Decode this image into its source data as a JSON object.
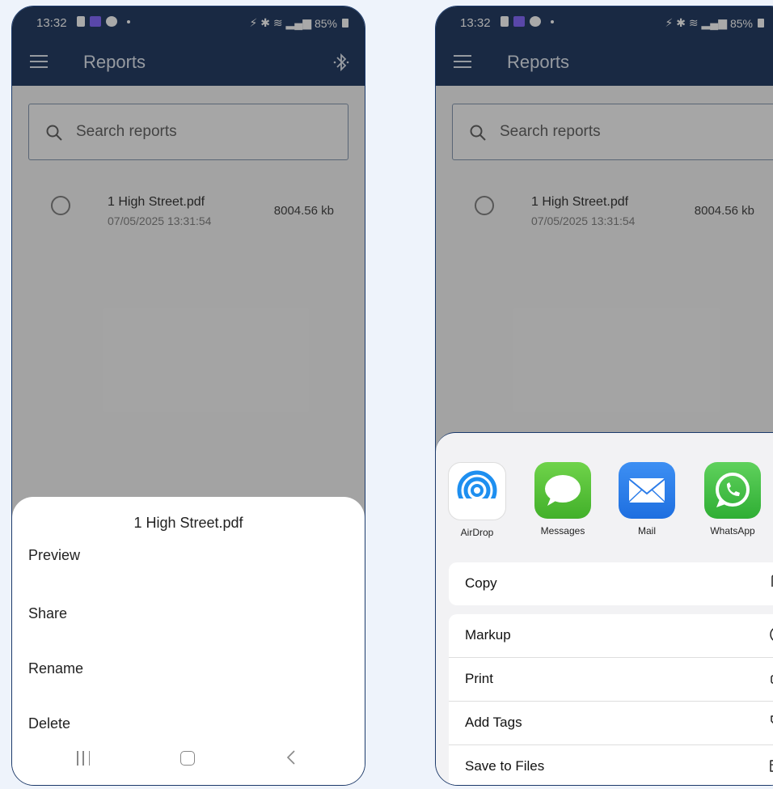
{
  "status_bar": {
    "time": "13:32",
    "battery": "85%"
  },
  "app_bar": {
    "title": "Reports"
  },
  "search": {
    "placeholder": "Search reports"
  },
  "reports": [
    {
      "name": "1 High Street.pdf",
      "date": "07/05/2025 13:31:54",
      "size": "8004.56 kb"
    }
  ],
  "android_sheet": {
    "title": "1 High Street.pdf",
    "items": [
      "Preview",
      "Share",
      "Rename",
      "Delete"
    ]
  },
  "ios_share": {
    "apps": [
      "AirDrop",
      "Messages",
      "Mail",
      "WhatsApp"
    ],
    "actions_group1": [
      "Copy"
    ],
    "actions_group2": [
      "Markup",
      "Print",
      "Add Tags",
      "Save to Files"
    ]
  },
  "colors": {
    "appbar": "#0f2a55",
    "messages_green": "#5bc236",
    "mail_blue": "#2b7ce9",
    "whatsapp_green": "#3bbd3f",
    "airdrop_blue": "#1e8ff0"
  }
}
